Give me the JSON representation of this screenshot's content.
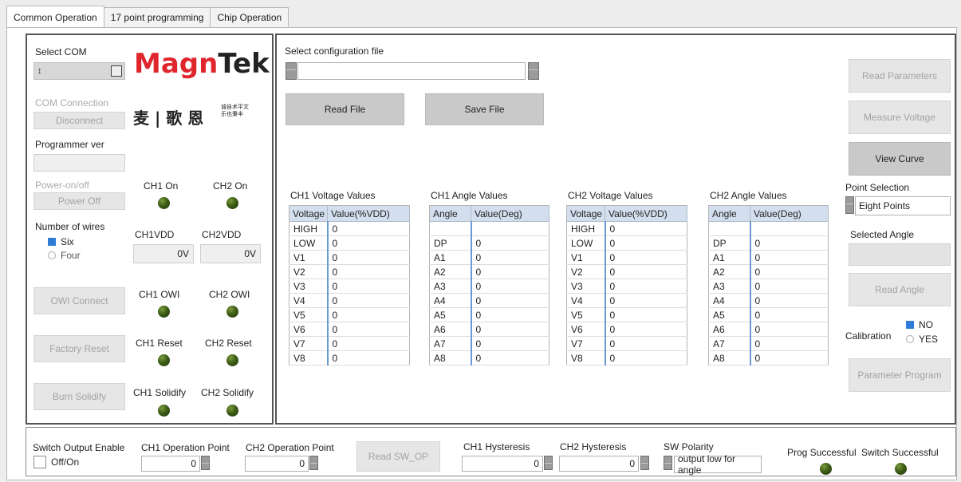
{
  "tabs": [
    "Common Operation",
    "17 point programming",
    "Chip Operation"
  ],
  "left": {
    "select_com_label": "Select COM",
    "com_value": "↕",
    "logo_mag": "Magn",
    "logo_tek": "Tek",
    "logo_cn": "麦 | 歌 恩",
    "logo_slogan": "诚自术平文 乐也秉丰",
    "com_connection_label": "COM Connection",
    "disconnect_btn": "Disconnect",
    "programmer_ver_label": "Programmer ver",
    "programmer_ver_value": "",
    "power_label": "Power-on/off",
    "power_btn": "Power Off",
    "ch1_on": "CH1 On",
    "ch2_on": "CH2 On",
    "wires_label": "Number of wires",
    "wire_six": "Six",
    "wire_four": "Four",
    "ch1vdd_label": "CH1VDD",
    "ch2vdd_label": "CH2VDD",
    "ch1vdd_value": "0V",
    "ch2vdd_value": "0V",
    "owi_connect_btn": "OWI Connect",
    "ch1_owi": "CH1 OWI",
    "ch2_owi": "CH2 OWI",
    "factory_reset_btn": "Factory Reset",
    "ch1_reset": "CH1 Reset",
    "ch2_reset": "CH2 Reset",
    "burn_solidify_btn": "Burn Solidify",
    "ch1_solidify": "CH1 Solidify",
    "ch2_solidify": "CH2 Solidify"
  },
  "main": {
    "select_config_label": "Select configuration file",
    "config_path": "",
    "read_file_btn": "Read File",
    "save_file_btn": "Save File",
    "ch1_voltage_title": "CH1 Voltage Values",
    "ch1_angle_title": "CH1 Angle Values",
    "ch2_voltage_title": "CH2 Voltage Values",
    "ch2_angle_title": "CH2 Angle Values",
    "voltage_headers": [
      "Voltage",
      "Value(%VDD)"
    ],
    "angle_headers": [
      "Angle",
      "Value(Deg)"
    ],
    "voltage_rows": [
      [
        "HIGH",
        "0"
      ],
      [
        "LOW",
        "0"
      ],
      [
        "V1",
        "0"
      ],
      [
        "V2",
        "0"
      ],
      [
        "V3",
        "0"
      ],
      [
        "V4",
        "0"
      ],
      [
        "V5",
        "0"
      ],
      [
        "V6",
        "0"
      ],
      [
        "V7",
        "0"
      ],
      [
        "V8",
        "0"
      ]
    ],
    "angle_rows": [
      [
        "",
        ""
      ],
      [
        "DP",
        "0"
      ],
      [
        "A1",
        "0"
      ],
      [
        "A2",
        "0"
      ],
      [
        "A3",
        "0"
      ],
      [
        "A4",
        "0"
      ],
      [
        "A5",
        "0"
      ],
      [
        "A6",
        "0"
      ],
      [
        "A7",
        "0"
      ],
      [
        "A8",
        "0"
      ]
    ]
  },
  "right": {
    "read_params_btn": "Read Parameters",
    "measure_voltage_btn": "Measure Voltage",
    "view_curve_btn": "View Curve",
    "point_selection_label": "Point Selection",
    "point_selection_value": "Eight Points",
    "selected_angle_label": "Selected Angle",
    "selected_angle_value": "",
    "read_angle_btn": "Read Angle",
    "calibration_label": "Calibration",
    "cal_no": "NO",
    "cal_yes": "YES",
    "param_program_btn": "Parameter Program"
  },
  "bottom": {
    "switch_output_label": "Switch Output Enable",
    "off_on": "Off/On",
    "ch1_op_label": "CH1 Operation Point",
    "ch1_op_value": "0",
    "ch2_op_label": "CH2 Operation Point",
    "ch2_op_value": "0",
    "read_sw_btn": "Read SW_OP",
    "ch1_hyst_label": "CH1 Hysteresis",
    "ch1_hyst_value": "0",
    "ch2_hyst_label": "CH2 Hysteresis",
    "ch2_hyst_value": "0",
    "sw_polarity_label": "SW Polarity",
    "sw_polarity_value": "output low for angle",
    "prog_success": "Prog Successful",
    "switch_success": "Switch Successful"
  },
  "colors": {
    "accent": "#2f7bd7",
    "led": "#3d5d16",
    "header": "#d3dfee",
    "logo_red": "#e0262d"
  }
}
